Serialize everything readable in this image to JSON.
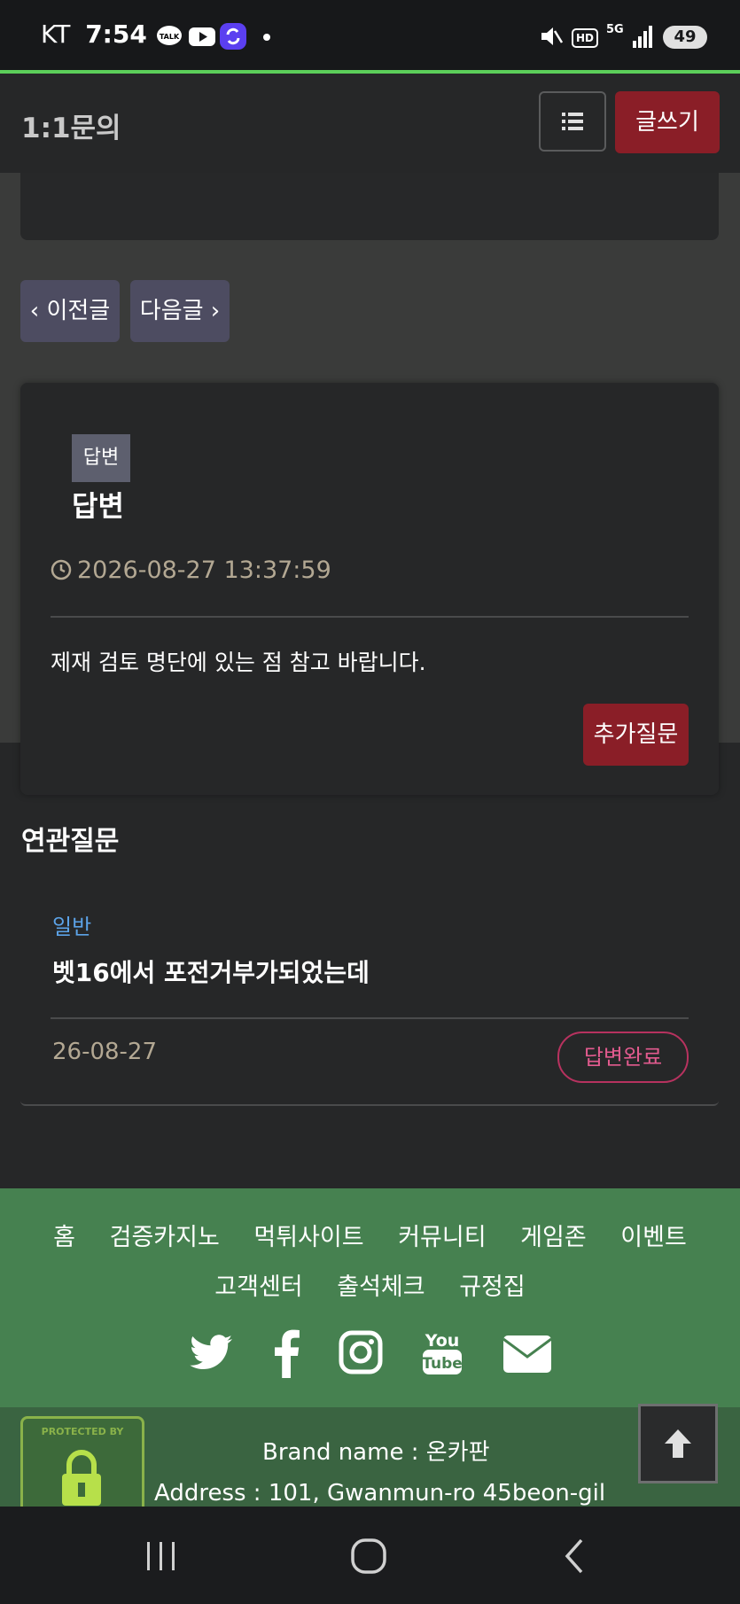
{
  "status_bar": {
    "carrier": "KT",
    "time": "7:54",
    "battery": "49",
    "network": "5G",
    "hd_label": "HD",
    "talk_label": "TALK"
  },
  "header": {
    "title": "1:1문의",
    "write_label": "글쓰기"
  },
  "nav": {
    "prev_label": "‹ 이전글",
    "next_label": "다음글 ›"
  },
  "answer": {
    "badge": "답변",
    "title": "답변",
    "datetime": "2026-08-27 13:37:59",
    "body": "제재 검토 명단에 있는 점 참고 바랍니다.",
    "followup_label": "추가질문"
  },
  "related": {
    "section_title": "연관질문",
    "items": [
      {
        "category": "일반",
        "title": "벳16에서 포전거부가되었는데",
        "date": "26-08-27",
        "status": "답변완료"
      }
    ]
  },
  "footer": {
    "links": [
      "홈",
      "검증카지노",
      "먹튀사이트",
      "커뮤니티",
      "게임존",
      "이벤트",
      "고객센터",
      "출석체크",
      "규정집"
    ],
    "social": [
      "twitter-icon",
      "facebook-icon",
      "instagram-icon",
      "youtube-icon",
      "mail-icon"
    ],
    "badge_text": "PROTECTED BY",
    "brand_line": "Brand name : 온카판",
    "address_line": "Address : 101, Gwanmun-ro 45beon-gil"
  },
  "colors": {
    "accent_red": "#8a1e27",
    "footer_green": "#468150",
    "status_pink": "#e35b8f",
    "category_blue": "#5ca3e8"
  }
}
